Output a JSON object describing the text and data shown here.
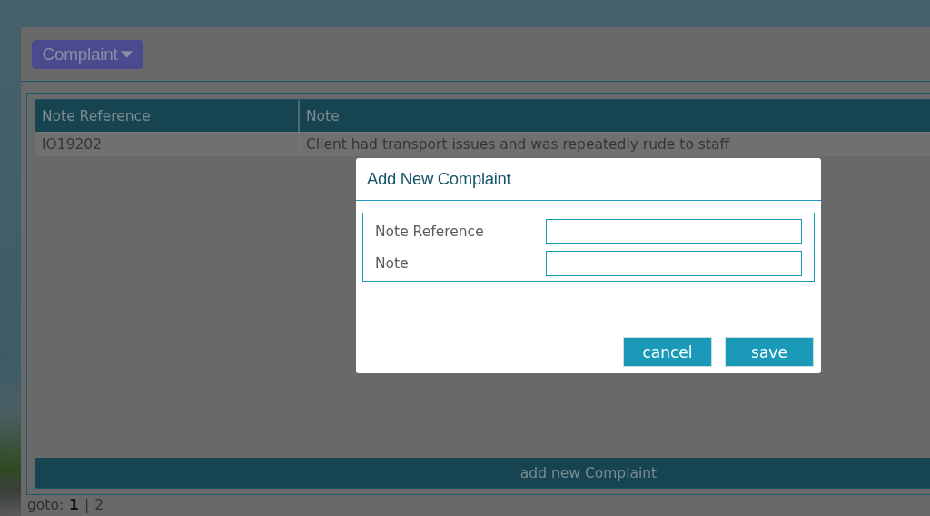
{
  "menu_button": {
    "label": "Complaint"
  },
  "table": {
    "columns": [
      "Note Reference",
      "Note"
    ],
    "rows": [
      [
        "IO19202",
        "Client had transport issues and was repeatedly rude to staff"
      ]
    ],
    "add_button": "add new Complaint"
  },
  "pagination": {
    "label": "goto:",
    "pages": [
      {
        "label": "1",
        "selected": true
      },
      {
        "label": "2",
        "selected": false
      }
    ],
    "separator": "|"
  },
  "dialog": {
    "title": "Add New Complaint",
    "fields": [
      {
        "label": "Note Reference"
      },
      {
        "label": "Note"
      }
    ],
    "buttons": [
      "cancel",
      "save"
    ]
  }
}
